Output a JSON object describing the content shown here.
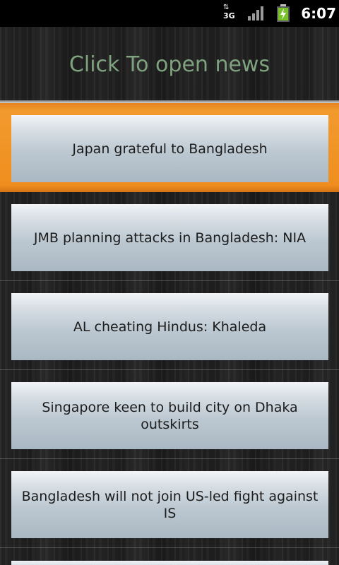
{
  "status_bar": {
    "network_type": "3G",
    "network_icon": "data-arrows-icon",
    "signal_icon": "signal-bars-icon",
    "battery_icon": "battery-charging-icon",
    "time": "6:07"
  },
  "header": {
    "title": "Click To open news",
    "title_color": "#7fa27f"
  },
  "news": {
    "selected_index": 0,
    "selection_color": "#f0901f",
    "items": [
      {
        "title": "Japan grateful to Bangladesh"
      },
      {
        "title": "JMB planning attacks in Bangladesh: NIA"
      },
      {
        "title": "AL cheating Hindus: Khaleda"
      },
      {
        "title": "Singapore keen to build city on Dhaka outskirts"
      },
      {
        "title": "Bangladesh will not join US-led fight against IS"
      }
    ]
  }
}
